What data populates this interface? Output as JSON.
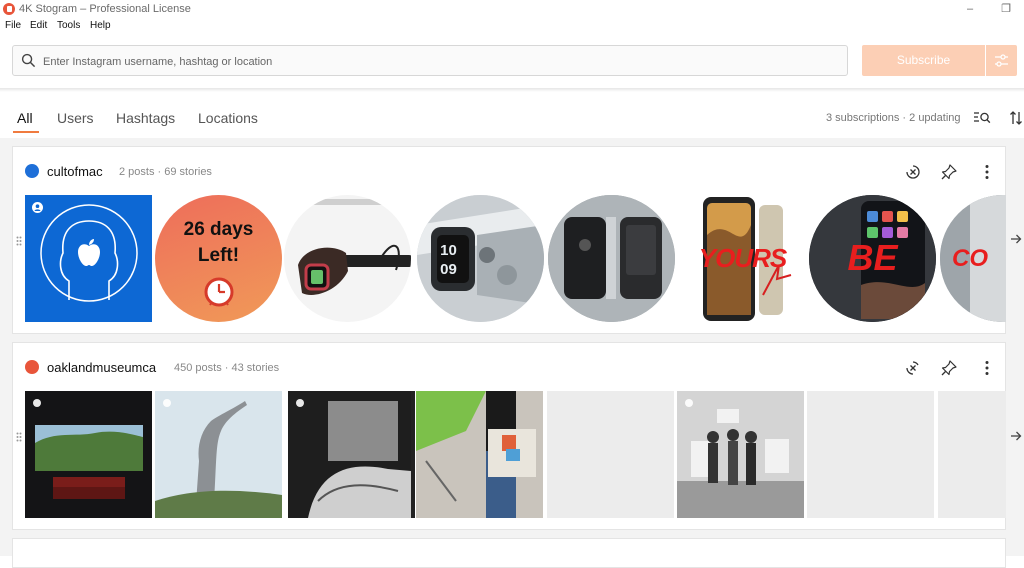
{
  "window": {
    "title": "4K Stogram – Professional License",
    "minimize_glyph": "–",
    "restore_glyph": "❐"
  },
  "menu": [
    "File",
    "Edit",
    "Tools",
    "Help"
  ],
  "search": {
    "placeholder": "Enter Instagram username, hashtag or location",
    "value": ""
  },
  "subscribe_label": "Subscribe",
  "tabs": [
    {
      "label": "All",
      "active": true
    },
    {
      "label": "Users",
      "active": false
    },
    {
      "label": "Hashtags",
      "active": false
    },
    {
      "label": "Locations",
      "active": false
    }
  ],
  "status_counts": "3 subscriptions · 2 updating",
  "subscriptions": [
    {
      "name": "cultofmac",
      "stats": "2 posts · 69 stories",
      "avatar_color": "#1e6fd8",
      "thumbnails": [
        {
          "kind": "apple-facetime-graphic"
        },
        {
          "kind": "countdown",
          "text_line1": "26 days",
          "text_line2": "Left!"
        },
        {
          "kind": "watch-on-wrist"
        },
        {
          "kind": "watch-closeup",
          "digits_top": "10",
          "digits_bottom": "09"
        },
        {
          "kind": "iphone-cases"
        },
        {
          "kind": "iphone-xs",
          "text": "YOURS"
        },
        {
          "kind": "iphone-screen",
          "text": "BE"
        },
        {
          "kind": "partial",
          "text": "CO"
        }
      ]
    },
    {
      "name": "oaklandmuseumca",
      "stats": "450 posts · 43 stories",
      "avatar_color": "#e8553a",
      "thumbnails": [
        {
          "kind": "theater-window"
        },
        {
          "kind": "sculpture"
        },
        {
          "kind": "bw-interior"
        },
        {
          "kind": "tote-bag"
        },
        {
          "kind": "placeholder"
        },
        {
          "kind": "protest-bw"
        },
        {
          "kind": "placeholder"
        },
        {
          "kind": "placeholder"
        }
      ]
    }
  ],
  "icons": {
    "search": "search-icon",
    "filter": "sliders-icon",
    "list_search": "list-search-icon",
    "sort": "sort-icon",
    "update": "update-circle-icon",
    "pin": "pin-icon",
    "more": "more-vertical-icon",
    "scroll_right": "arrow-right-icon"
  },
  "colors": {
    "accent": "#f07b3f",
    "subscribe_disabled": "#fccfb5"
  }
}
